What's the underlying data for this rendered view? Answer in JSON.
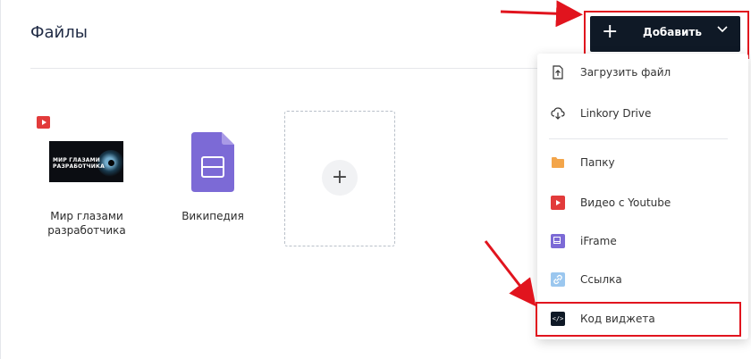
{
  "page": {
    "title": "Файлы"
  },
  "files": [
    {
      "name_line1": "Мир глазами",
      "name_line2": "разработчика",
      "type": "youtube",
      "thumb_text_line1": "МИР ГЛАЗАМИ",
      "thumb_text_line2": "РАЗРАБОТЧИКА"
    },
    {
      "name": "Википедия",
      "type": "iframe-doc"
    }
  ],
  "add_tile": {
    "icon": "plus-icon"
  },
  "add_button": {
    "label": "Добавить",
    "icon_left": "plus-icon",
    "icon_right": "chevron-down-icon",
    "bg": "#0f1926"
  },
  "menu": {
    "items": [
      {
        "label": "Загрузить файл",
        "icon": "upload-file-icon"
      },
      {
        "label": "Linkory Drive",
        "icon": "cloud-download-icon"
      },
      {
        "label": "Папку",
        "icon": "folder-icon"
      },
      {
        "label": "Видео с Youtube",
        "icon": "youtube-icon"
      },
      {
        "label": "iFrame",
        "icon": "iframe-icon"
      },
      {
        "label": "Ссылка",
        "icon": "link-icon"
      },
      {
        "label": "Код виджета",
        "icon": "code-icon"
      }
    ]
  },
  "colors": {
    "highlight": "#e1141e",
    "youtube": "#e23b3b",
    "iframe": "#7c6ad6",
    "folder": "#f3a54a",
    "link": "#9bc7ef"
  }
}
